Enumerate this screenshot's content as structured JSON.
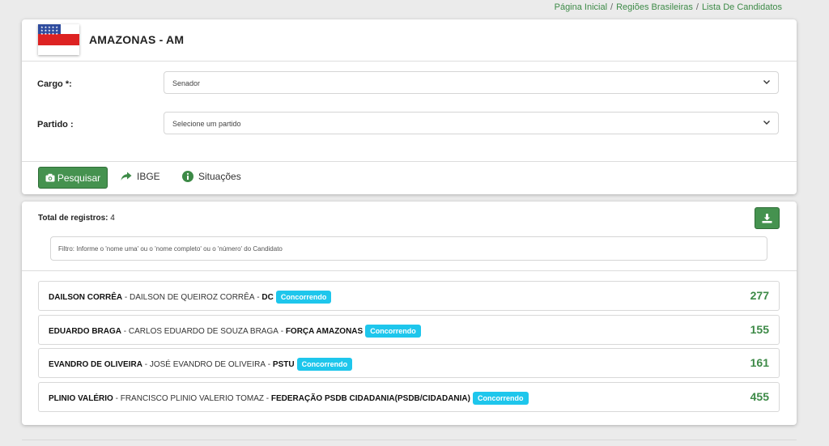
{
  "breadcrumb": [
    "Página Inicial",
    "Regiões Brasileiras",
    "Lista De Candidatos"
  ],
  "state": {
    "title": "AMAZONAS - AM",
    "flag_colors": [
      "#2f4c9e",
      "#ffffff",
      "#dd2222"
    ]
  },
  "form": {
    "cargo_label": "Cargo *:",
    "cargo_value": "Senador",
    "partido_label": "Partido :",
    "partido_placeholder": "Selecione um partido"
  },
  "actions": {
    "pesquisar": "Pesquisar",
    "ibge": "IBGE",
    "situacoes": "Situações"
  },
  "results": {
    "total_label": "Total de registros:",
    "total_value": "4",
    "filter_placeholder": "Filtro: Informe o 'nome uma' ou o 'nome completo' ou o 'número' do Candidato",
    "candidates": [
      {
        "short_name": "DAILSON CORRÊA",
        "full_name": "DAILSON DE QUEIROZ CORRÊA",
        "party": "DC",
        "status": "Concorrendo",
        "number": "277"
      },
      {
        "short_name": "EDUARDO BRAGA",
        "full_name": "CARLOS EDUARDO DE SOUZA BRAGA",
        "party": "FORÇA AMAZONAS",
        "status": "Concorrendo",
        "number": "155"
      },
      {
        "short_name": "EVANDRO DE OLIVEIRA",
        "full_name": "JOSÉ EVANDRO DE OLIVEIRA",
        "party": "PSTU",
        "status": "Concorrendo",
        "number": "161"
      },
      {
        "short_name": "PLINIO VALÉRIO",
        "full_name": "FRANCISCO PLINIO VALERIO TOMAZ",
        "party": "FEDERAÇÃO PSDB CIDADANIA(PSDB/CIDADANIA)",
        "status": "Concorrendo",
        "number": "455"
      }
    ]
  },
  "colors": {
    "accent_green": "#45924f",
    "badge_blue": "#1ec6ec",
    "number_green": "#3d8a47"
  }
}
